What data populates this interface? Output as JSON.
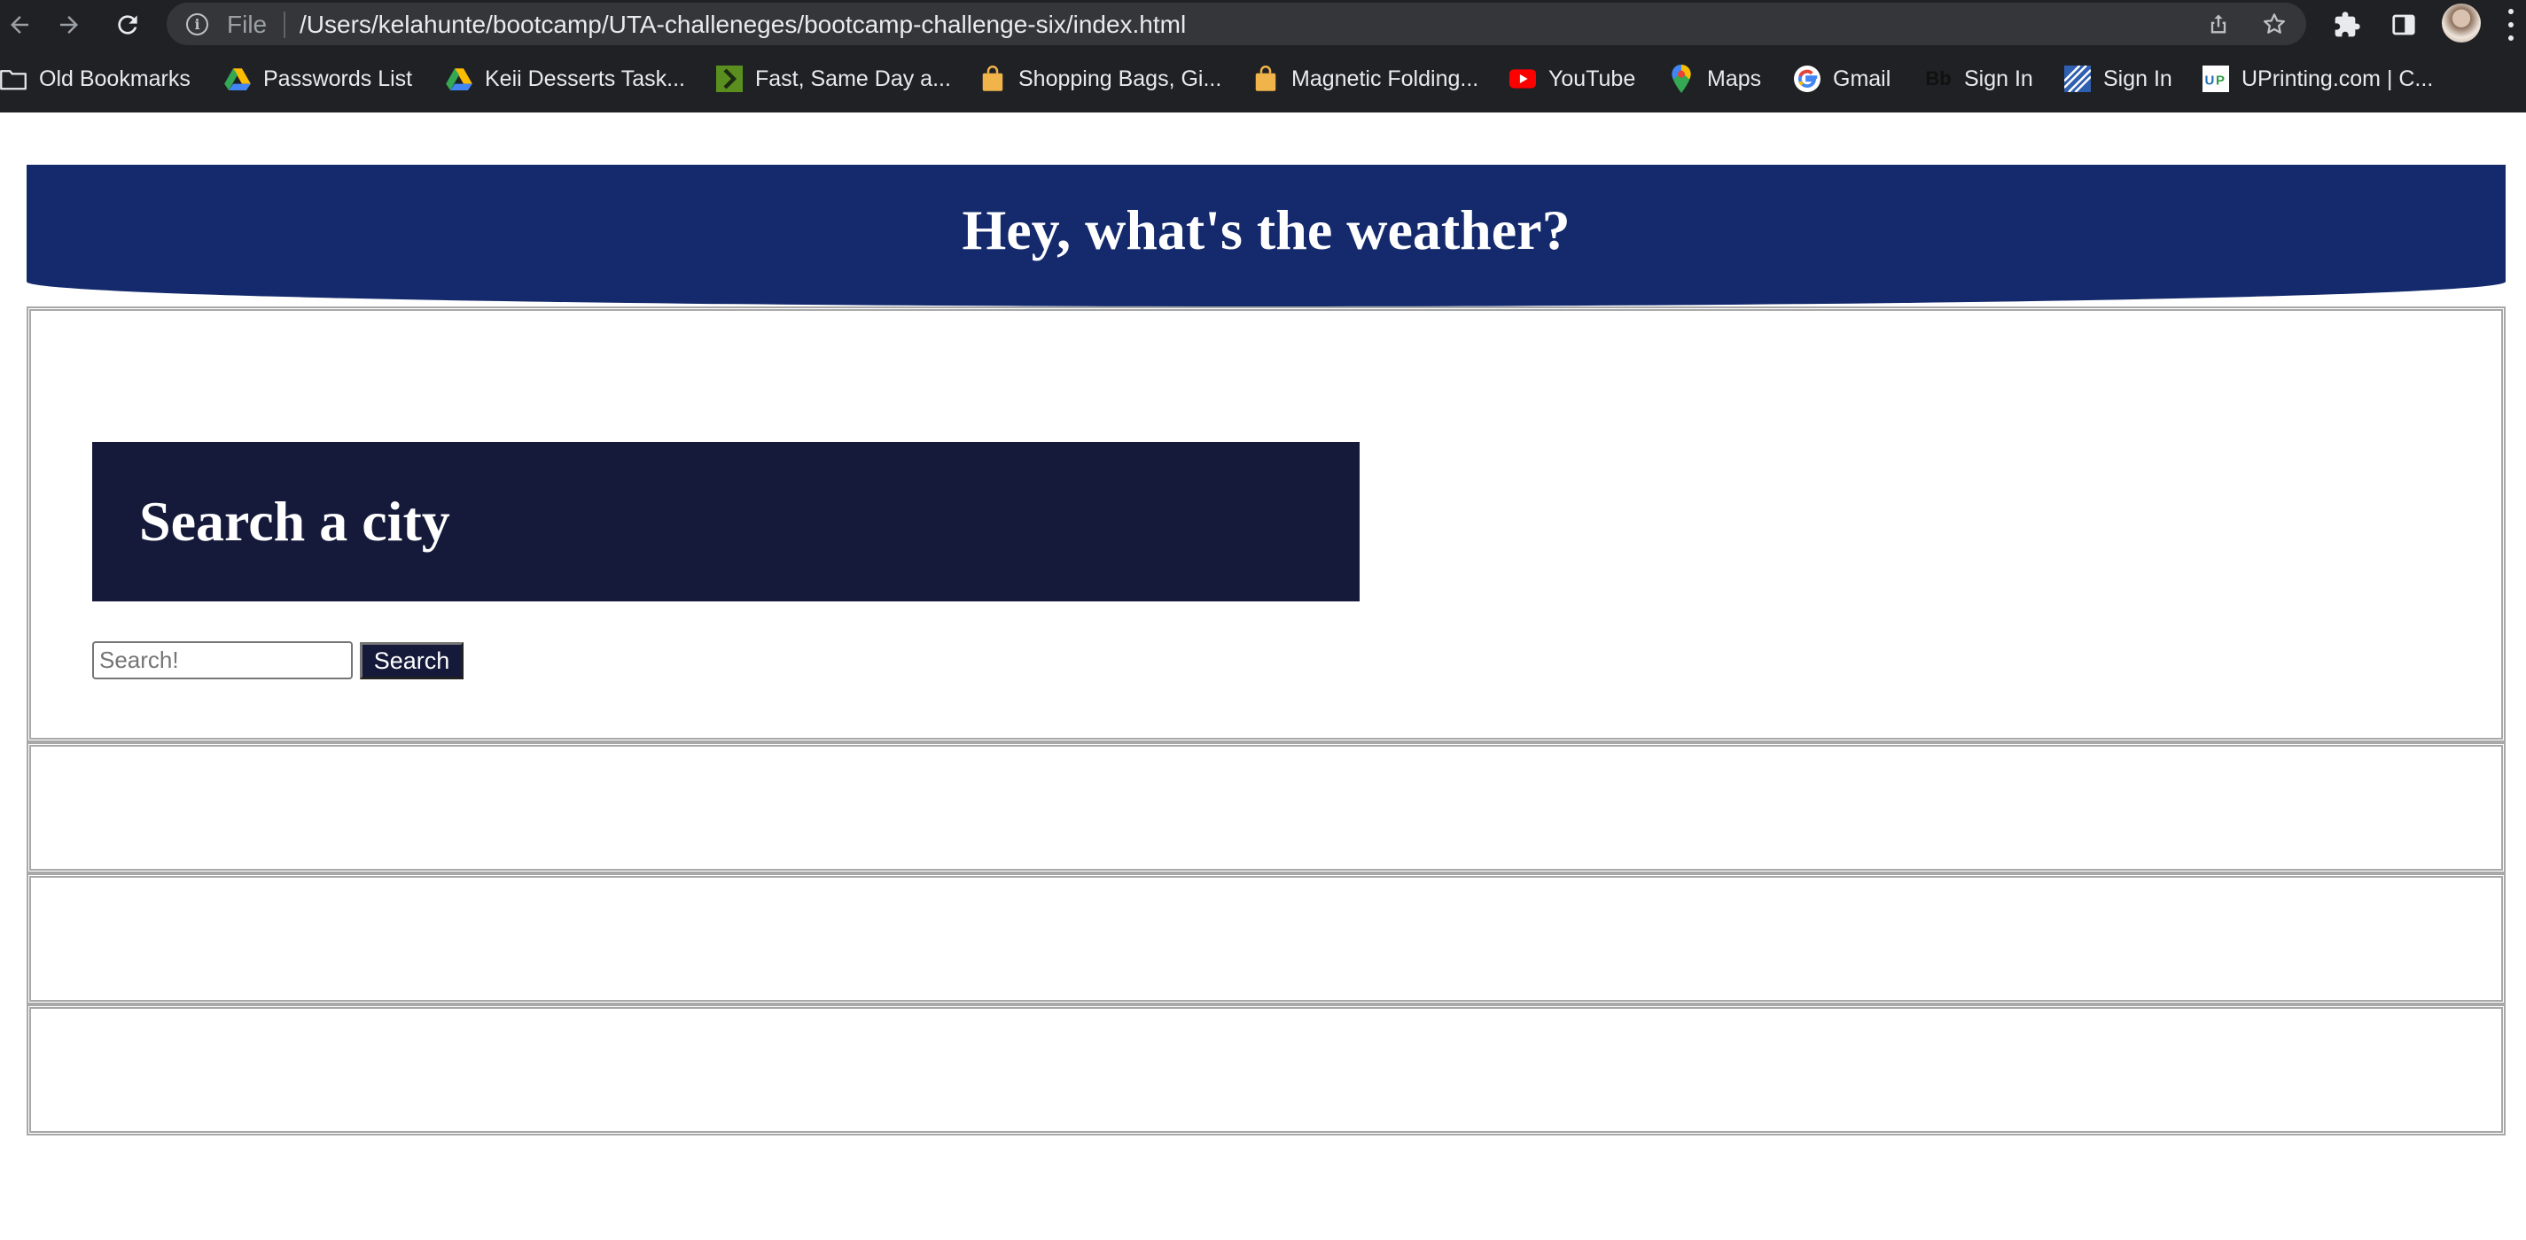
{
  "browser": {
    "address_bar": {
      "scheme_label": "File",
      "url": "/Users/kelahunte/bootcamp/UTA-challeneges/bootcamp-challenge-six/index.html"
    },
    "bookmarks": [
      {
        "label": "Old Bookmarks",
        "icon": "folder-icon"
      },
      {
        "label": "Passwords List",
        "icon": "google-drive-icon"
      },
      {
        "label": "Keii Desserts Task...",
        "icon": "google-drive-icon"
      },
      {
        "label": "Fast, Same Day a...",
        "icon": "green-chevron-icon"
      },
      {
        "label": "Shopping Bags, Gi...",
        "icon": "shopping-bag-icon"
      },
      {
        "label": "Magnetic Folding...",
        "icon": "shopping-bag-icon"
      },
      {
        "label": "YouTube",
        "icon": "youtube-icon"
      },
      {
        "label": "Maps",
        "icon": "maps-pin-icon"
      },
      {
        "label": "Gmail",
        "icon": "google-g-icon"
      },
      {
        "label": "Sign In",
        "icon": "blackboard-icon"
      },
      {
        "label": "Sign In",
        "icon": "striped-logo-icon"
      },
      {
        "label": "UPrinting.com | C...",
        "icon": "uprinting-icon"
      }
    ]
  },
  "page": {
    "header_title": "Hey, what's the weather?",
    "search": {
      "heading": "Search a city",
      "placeholder": "Search!",
      "button_label": "Search"
    }
  },
  "colors": {
    "header_bg": "#142a6c",
    "search_heading_bg": "#151a3a",
    "button_bg": "#151a3a",
    "chrome_bg": "#202124"
  }
}
